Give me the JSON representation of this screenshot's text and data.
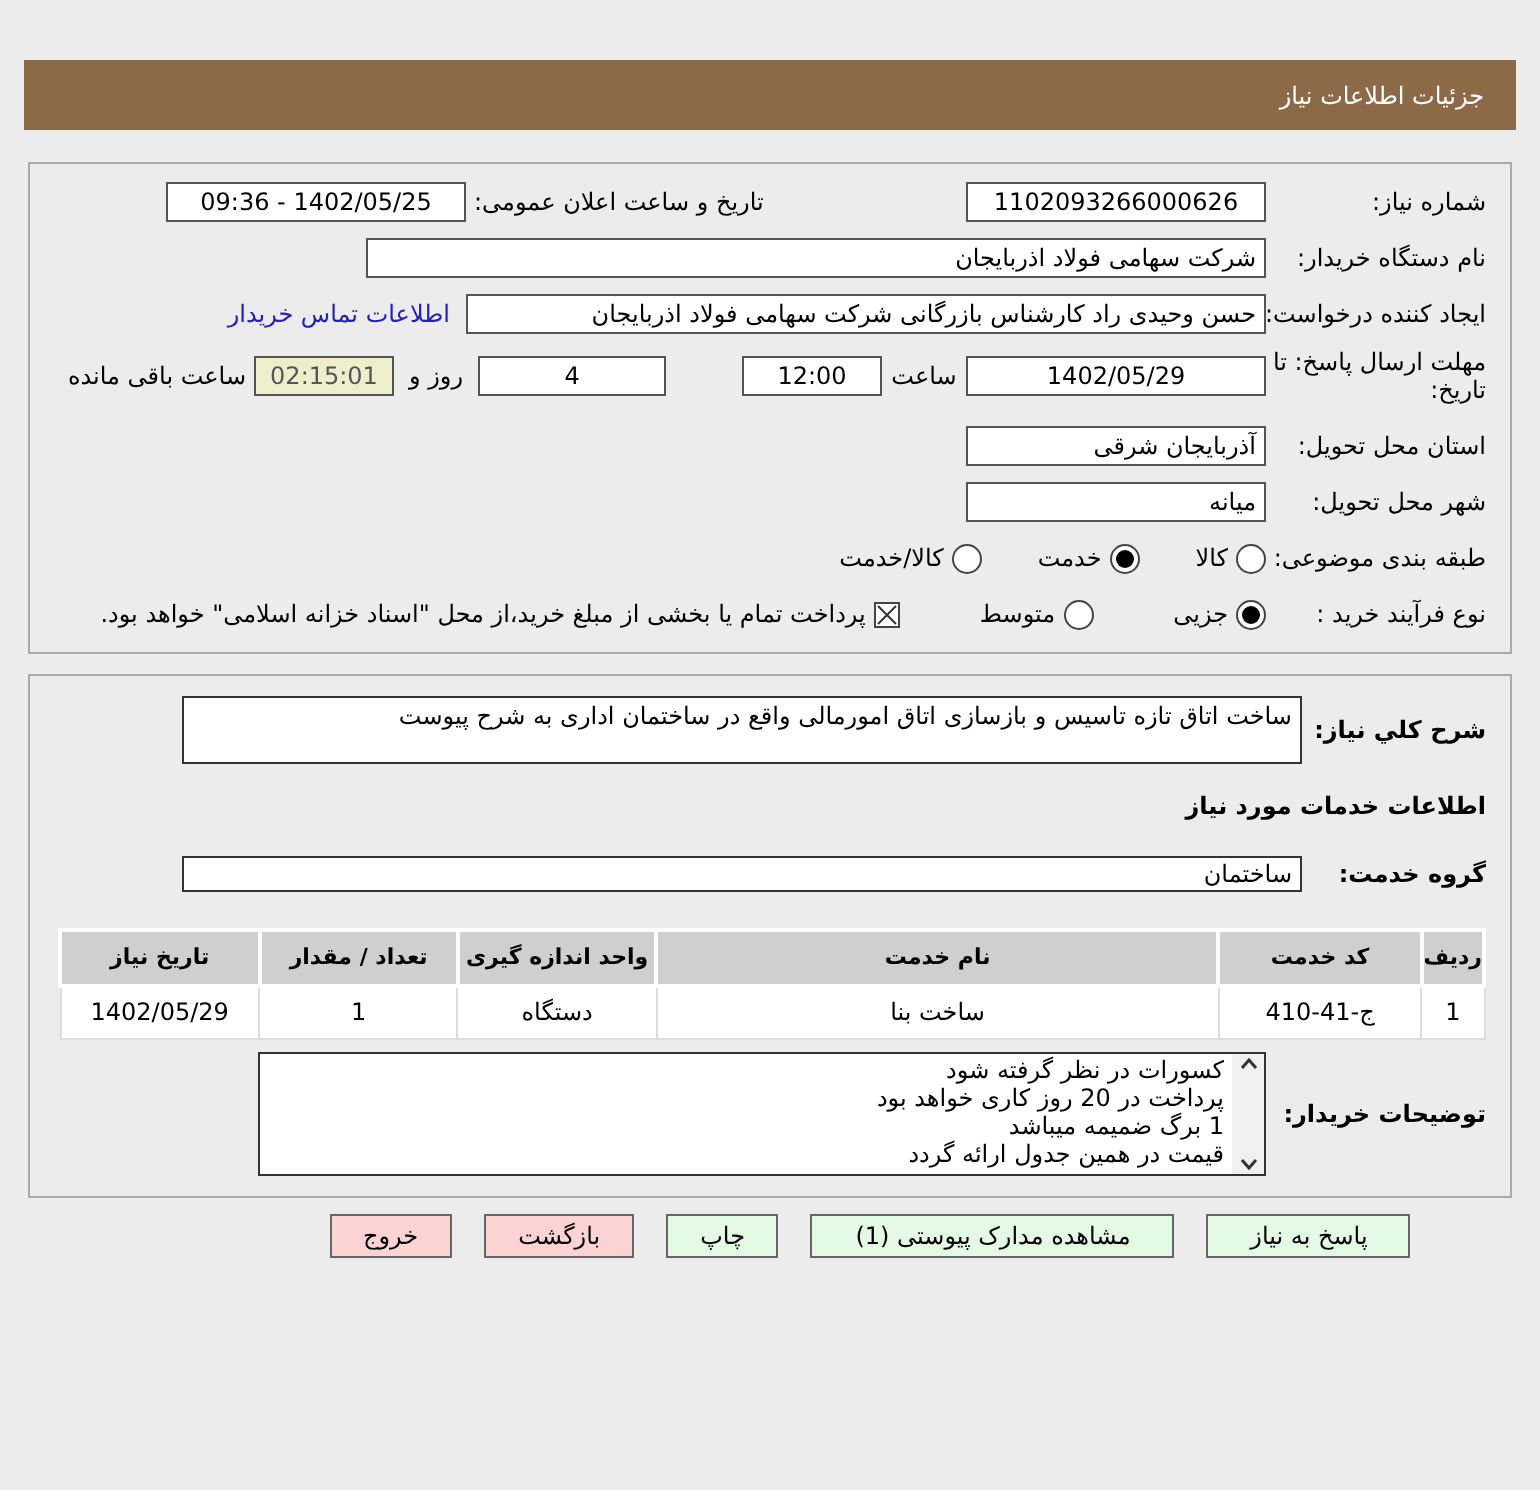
{
  "header": {
    "title": "جزئیات اطلاعات نیاز"
  },
  "need_number": {
    "label": "شماره نیاز:",
    "value": "1102093266000626"
  },
  "announce": {
    "label": "تاریخ و ساعت اعلان عمومی:",
    "value": "1402/05/25 - 09:36"
  },
  "buyer_org": {
    "label": "نام دستگاه خریدار:",
    "value": "شرکت سهامی فولاد اذربایجان"
  },
  "requester": {
    "label": "ایجاد کننده درخواست:",
    "value": "حسن وحیدی راد کارشناس بازرگانی شرکت سهامی فولاد اذربایجان",
    "link": "اطلاعات تماس خریدار"
  },
  "deadline": {
    "label": "مهلت ارسال پاسخ: تا تاریخ:",
    "date": "1402/05/29",
    "time_label": "ساعت",
    "time": "12:00",
    "days": "4",
    "days_label": "روز و",
    "remaining": "02:15:01",
    "remaining_label": "ساعت باقی مانده"
  },
  "province": {
    "label": "استان محل تحویل:",
    "value": "آذربایجان شرقی"
  },
  "city": {
    "label": "شهر محل تحویل:",
    "value": "میانه"
  },
  "category": {
    "label": "طبقه بندی موضوعی:",
    "options": [
      {
        "label": "کالا",
        "selected": false
      },
      {
        "label": "خدمت",
        "selected": true
      },
      {
        "label": "کالا/خدمت",
        "selected": false
      }
    ]
  },
  "process": {
    "label": "نوع فرآیند خرید :",
    "options": [
      {
        "label": "جزیی",
        "selected": true
      },
      {
        "label": "متوسط",
        "selected": false
      }
    ],
    "treasury": {
      "checked": true,
      "text": "پرداخت تمام یا بخشی از مبلغ خرید،از محل \"اسناد خزانه اسلامی\" خواهد بود."
    }
  },
  "description": {
    "label": "شرح کلي نیاز:",
    "value": "ساخت اتاق تازه تاسیس و بازسازی اتاق امورمالی واقع در ساختمان اداری به شرح پیوست"
  },
  "services_title": "اطلاعات خدمات مورد نیاز",
  "service_group": {
    "label": "گروه خدمت:",
    "value": "ساختمان"
  },
  "table": {
    "columns": [
      "ردیف",
      "کد خدمت",
      "نام خدمت",
      "واحد اندازه گیری",
      "تعداد / مقدار",
      "تاریخ نیاز"
    ],
    "rows": [
      [
        "1",
        "ج-41-410",
        "ساخت بنا",
        "دستگاه",
        "1",
        "1402/05/29"
      ]
    ]
  },
  "buyer_notes": {
    "label": "توضیحات خریدار:",
    "lines": [
      "کسورات در نظر گرفته شود",
      "پرداخت در 20 روز کاری خواهد بود",
      "1 برگ ضمیمه میباشد",
      "قیمت در همین جدول ارائه گردد"
    ]
  },
  "buttons": [
    {
      "label": "پاسخ به نیاز",
      "kind": "normal"
    },
    {
      "label": "مشاهده مدارک پیوستی (1)",
      "kind": "normal"
    },
    {
      "label": "چاپ",
      "kind": "normal"
    },
    {
      "label": "بازگشت",
      "kind": "danger"
    },
    {
      "label": "خروج",
      "kind": "danger"
    }
  ]
}
